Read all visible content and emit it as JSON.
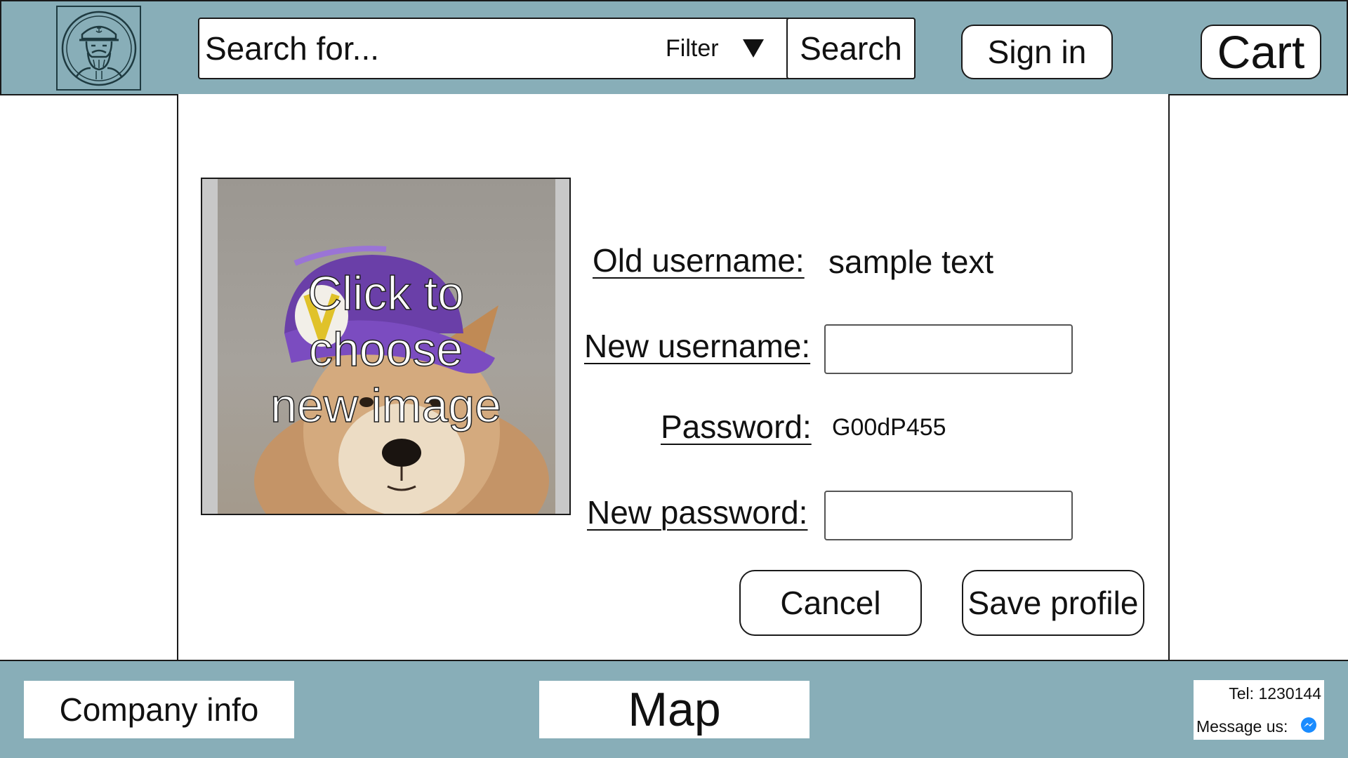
{
  "header": {
    "search": {
      "placeholder": "Search for...",
      "filter_label": "Filter",
      "search_button": "Search"
    },
    "sign_in": "Sign in",
    "cart": "Cart",
    "logo_icon": "sea-captain-logo"
  },
  "profile": {
    "image_caption": "Click to\nchoose\nnew image",
    "old_username": {
      "label": "Old username:",
      "value": "sample text"
    },
    "new_username": {
      "label": "New username:",
      "value": ""
    },
    "password": {
      "label": "Password:",
      "value": "G00dP455"
    },
    "new_password": {
      "label": "New password:",
      "value": ""
    },
    "cancel_button": "Cancel",
    "save_button": "Save profile"
  },
  "footer": {
    "company_info": "Company info",
    "map": "Map",
    "tel": "Tel: 1230144",
    "message_us": "Message us:",
    "messenger_icon": "messenger-icon"
  },
  "colors": {
    "header_bg": "#88aeb8",
    "footer_bg": "#88aeb8",
    "messenger_blue": "#1a8cff"
  }
}
